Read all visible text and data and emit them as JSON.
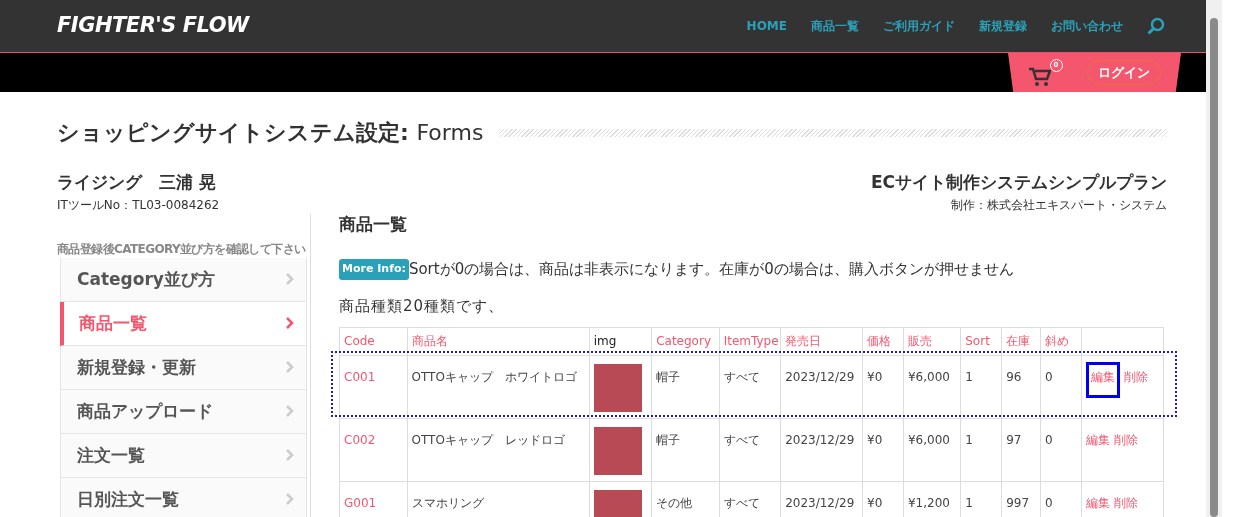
{
  "logo": "FIGHTER'S FLOW",
  "nav": [
    "HOME",
    "商品一覧",
    "ご利用ガイド",
    "新規登録",
    "お問い合わせ"
  ],
  "cart": {
    "count": "0"
  },
  "login": "ログイン",
  "page_title": {
    "main": "ショッピングサイトシステム設定:",
    "sub": "Forms"
  },
  "client": {
    "name": "ライジング　三浦 晃",
    "tool_no": "ITツールNo：TL03-0084262"
  },
  "plan": {
    "name": "ECサイト制作システムシンプルプラン",
    "maker": "制作：株式会社エキスパート・システム"
  },
  "sidebar": {
    "note": "商品登録後CATEGORY並び方を確認して下さい",
    "items": [
      {
        "label": "Category並び方",
        "selected": false
      },
      {
        "label": "商品一覧",
        "selected": true
      },
      {
        "label": "新規登録・更新",
        "selected": false
      },
      {
        "label": "商品アップロード",
        "selected": false
      },
      {
        "label": "注文一覧",
        "selected": false
      },
      {
        "label": "日別注文一覧",
        "selected": false
      }
    ]
  },
  "section_title": "商品一覧",
  "info": {
    "badge": "More Info:",
    "text": "Sortが0の場合は、商品は非表示になります。在庫が0の場合は、購入ボタンが押せません"
  },
  "count_text": "商品種類20種類です、",
  "table": {
    "columns": [
      "Code",
      "商品名",
      "img",
      "Category",
      "ItemType",
      "発売日",
      "価格",
      "販売",
      "Sort",
      "在庫",
      "斜め"
    ],
    "rows": [
      {
        "code": "C001",
        "name": "OTTOキャップ　ホワイトロゴ",
        "category": "帽子",
        "item_type": "すべて",
        "date": "2023/12/29",
        "price": "¥0",
        "sale": "¥6,000",
        "sort": "1",
        "stock": "96",
        "col_11": "0",
        "edit": "編集",
        "delete": "削除"
      },
      {
        "code": "C002",
        "name": "OTTOキャップ　レッドロゴ",
        "category": "帽子",
        "item_type": "すべて",
        "date": "2023/12/29",
        "price": "¥0",
        "sale": "¥6,000",
        "sort": "1",
        "stock": "97",
        "col_11": "0",
        "edit": "編集",
        "delete": "削除"
      },
      {
        "code": "G001",
        "name": "スマホリング",
        "category": "その他",
        "item_type": "すべて",
        "date": "2023/12/29",
        "price": "¥0",
        "sale": "¥1,200",
        "sort": "1",
        "stock": "997",
        "col_11": "0",
        "edit": "編集",
        "delete": "削除"
      }
    ]
  }
}
